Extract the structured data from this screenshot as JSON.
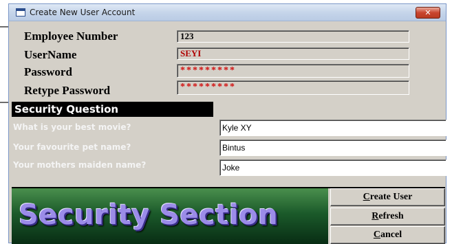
{
  "window": {
    "title": "Create New User Account",
    "close_label": "✕"
  },
  "account": {
    "employee_number_label": "Employee Number",
    "employee_number_value": "123",
    "username_label": "UserName",
    "username_value": "SEYI",
    "password_label": "Password",
    "password_value": "*********",
    "retype_password_label": "Retype Password",
    "retype_password_value": "*********"
  },
  "security": {
    "header": "Security Question",
    "questions": [
      {
        "label": "What is your best movie?",
        "answer": "Kyle XY"
      },
      {
        "label": "Your favourite pet name?",
        "answer": "Bintus"
      },
      {
        "label": "Your mothers maiden name?",
        "answer": "Joke"
      }
    ]
  },
  "banner": {
    "text": "Security Section"
  },
  "buttons": {
    "create_first": "C",
    "create_rest": "reate User",
    "refresh_first": "R",
    "refresh_rest": "efresh",
    "cancel_first": "C",
    "cancel_rest": "ancel"
  },
  "colors": {
    "password_text": "#d21010",
    "username_text": "#b00000",
    "banner_bg": "#1b5a2a",
    "banner_text": "#9b8ce8"
  }
}
